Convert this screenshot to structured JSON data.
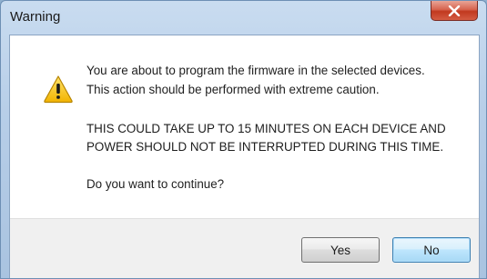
{
  "window": {
    "title": "Warning",
    "close_glyph": "✕"
  },
  "dialog": {
    "icon": "warning-triangle-icon",
    "line1": "You are about to program the firmware in the selected devices.",
    "line2": "This action should be performed with extreme caution.",
    "line3": "THIS COULD TAKE UP TO 15 MINUTES ON EACH DEVICE AND",
    "line4": "POWER SHOULD NOT BE INTERRUPTED DURING THIS TIME.",
    "line5": "Do you want to continue?"
  },
  "buttons": {
    "yes_label": "Yes",
    "no_label": "No"
  },
  "colors": {
    "titlebar": "#b7cee8",
    "close_button": "#c1391f",
    "warning_yellow": "#f5c400",
    "default_button_border": "#3c7fb1"
  }
}
